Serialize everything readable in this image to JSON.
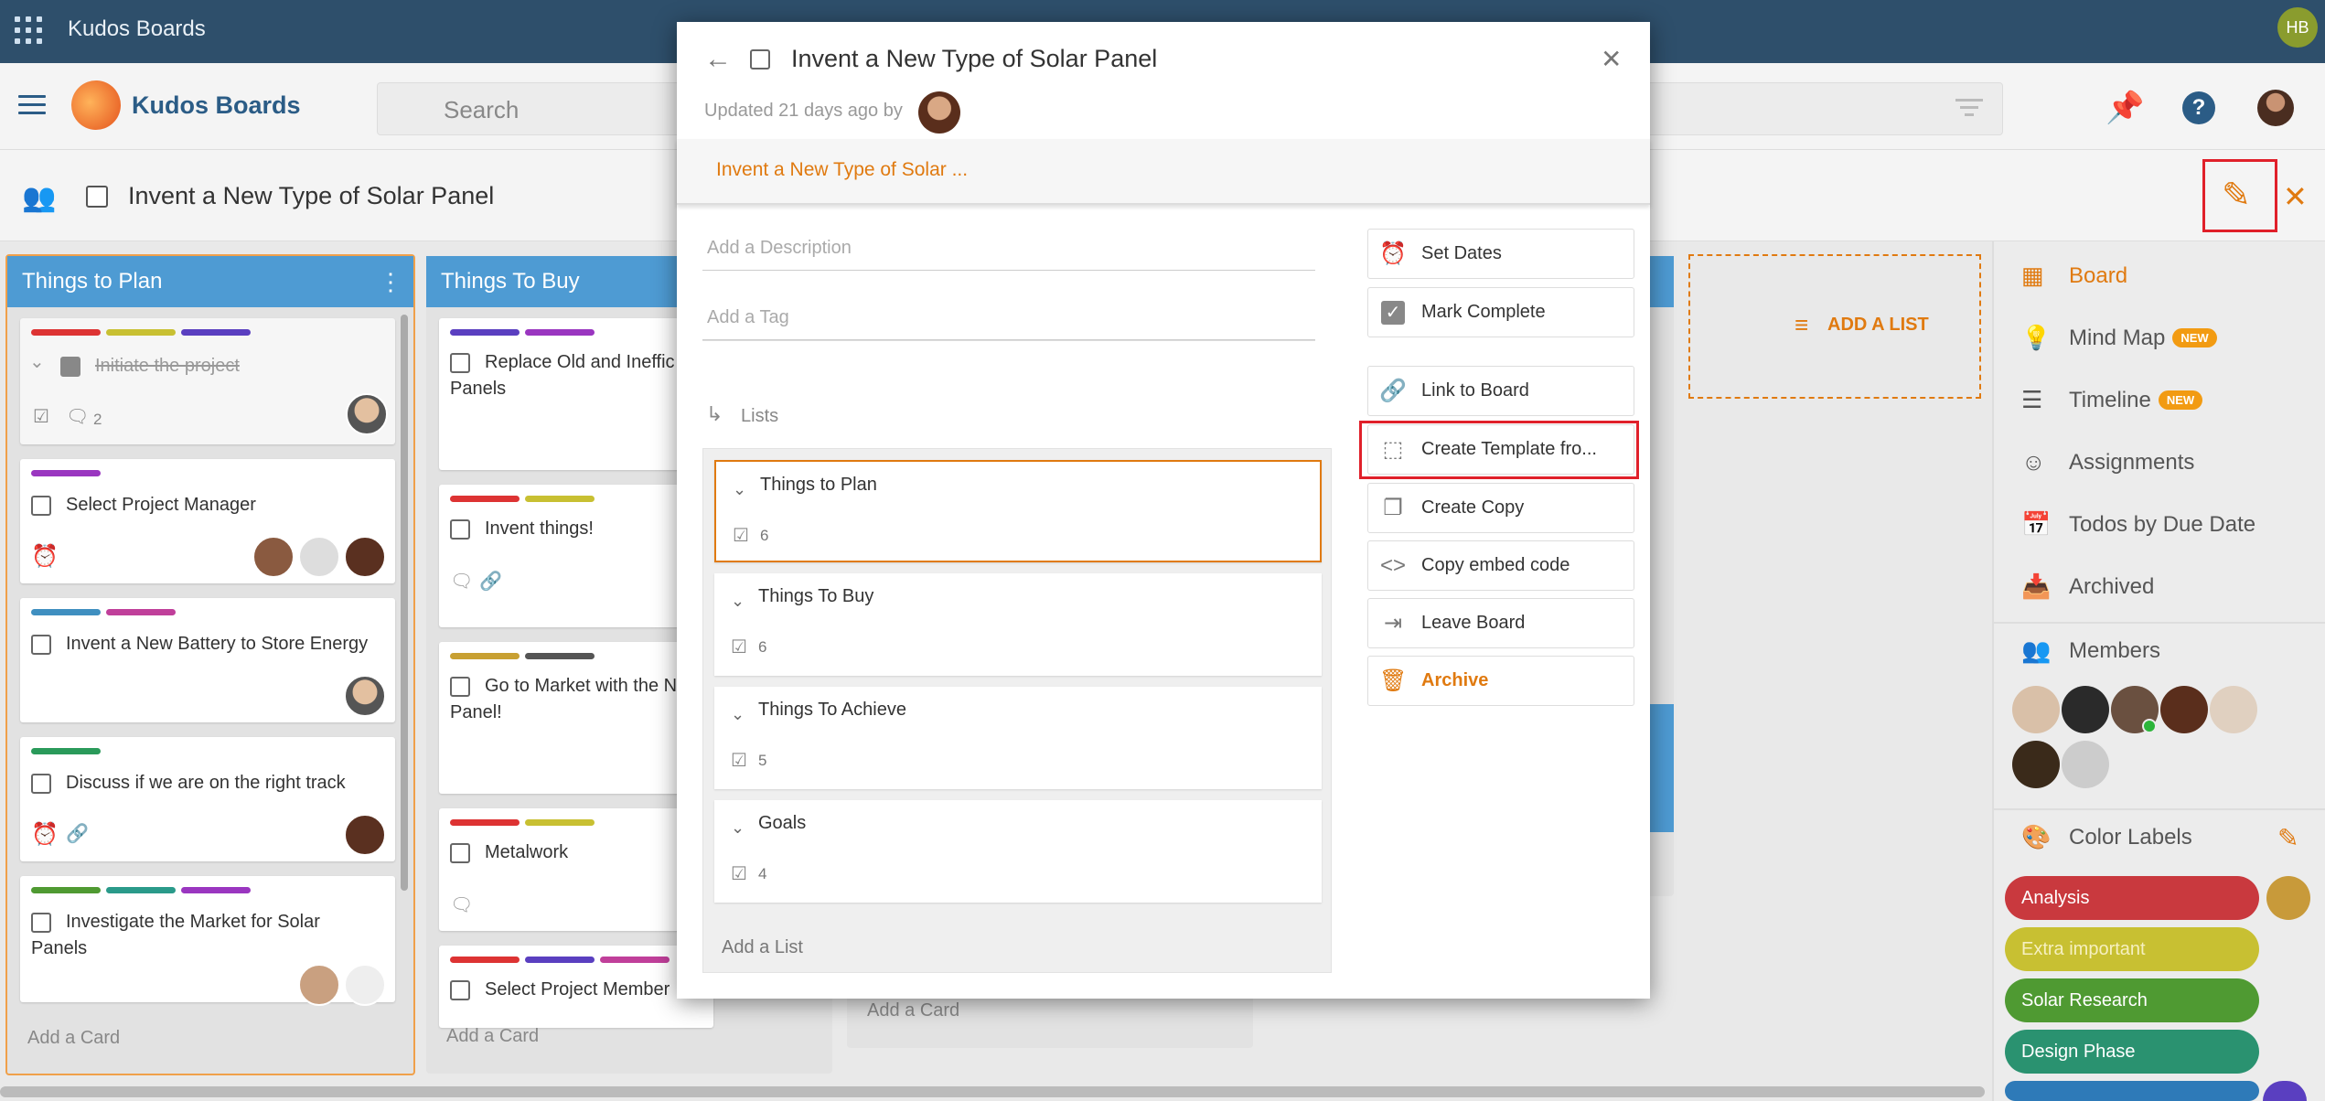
{
  "topbar": {
    "app_title": "Kudos Boards",
    "user_initials": "HB"
  },
  "header": {
    "brand": "Kudos Boards",
    "search_placeholder": "Search"
  },
  "board": {
    "title": "Invent a New Type of Solar Panel"
  },
  "columns": [
    {
      "title": "Things to Plan",
      "add_card": "Add a Card",
      "cards": [
        {
          "text": "Initiate the project",
          "comment_count": "2"
        },
        {
          "text": "Select Project Manager"
        },
        {
          "text": "Invent a New Battery to Store Energy"
        },
        {
          "text": "Discuss if we are on the right track"
        },
        {
          "text": "Investigate the Market for Solar Panels"
        }
      ]
    },
    {
      "title": "Things To Buy",
      "add_card": "Add a Card",
      "cards": [
        {
          "text": "Replace Old and Ineffic Panels"
        },
        {
          "text": "Invent things!"
        },
        {
          "text": "Go to Market with the N Panel!"
        },
        {
          "text": "Metalwork"
        },
        {
          "text": "Select Project Member"
        }
      ]
    },
    {
      "add_card": "Add a Card"
    }
  ],
  "add_list_label": "ADD A LIST",
  "modal": {
    "title": "Invent a New Type of Solar Panel",
    "updated": "Updated 21 days ago by",
    "breadcrumb": "Invent a New Type of Solar ...",
    "description_placeholder": "Add a Description",
    "tag_placeholder": "Add a Tag",
    "lists_label": "Lists",
    "lists": [
      {
        "name": "Things to Plan",
        "count": "6"
      },
      {
        "name": "Things To Buy",
        "count": "6"
      },
      {
        "name": "Things To Achieve",
        "count": "5"
      },
      {
        "name": "Goals",
        "count": "4"
      }
    ],
    "add_list": "Add a List",
    "actions": {
      "set_dates": "Set Dates",
      "mark_complete": "Mark Complete",
      "link_to_board": "Link to Board",
      "create_template": "Create Template fro...",
      "create_copy": "Create Copy",
      "copy_embed": "Copy embed code",
      "leave_board": "Leave Board",
      "archive": "Archive"
    }
  },
  "right_panel": {
    "board": "Board",
    "mind_map": "Mind Map",
    "timeline": "Timeline",
    "new_badge": "NEW",
    "assignments": "Assignments",
    "todos": "Todos by Due Date",
    "archived": "Archived",
    "members": "Members",
    "color_labels": "Color Labels",
    "labels": [
      {
        "name": "Analysis",
        "color": "#c9393e"
      },
      {
        "name": "Extra important",
        "color": "#c8c032"
      },
      {
        "name": "Solar Research",
        "color": "#4f9a32"
      },
      {
        "name": "Design Phase",
        "color": "#2a9270"
      }
    ]
  },
  "colors": {
    "accent": "#e07a10",
    "header_blue": "#2e4f6b",
    "column_blue": "#4e9bd3",
    "highlight_red": "#e0202a"
  }
}
